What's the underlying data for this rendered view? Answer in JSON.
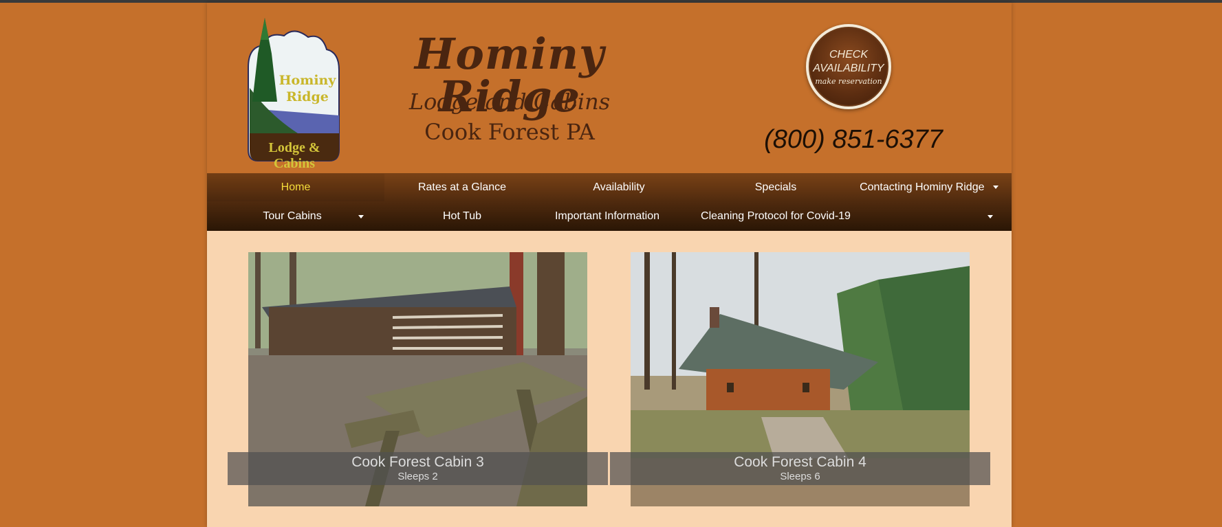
{
  "logo": {
    "line1": "Hominy",
    "line2": "Ridge",
    "line3": "Lodge & Cabins"
  },
  "header": {
    "title": "Hominy Ridge",
    "subtitle1": "Lodge and Cabins",
    "subtitle2": "Cook Forest PA",
    "check_availability": {
      "line1": "CHECK",
      "line2": "AVAILABILITY",
      "line3": "make reservation"
    },
    "phone": "(800) 851-6377"
  },
  "nav": {
    "row1": [
      {
        "label": "Home",
        "active": true
      },
      {
        "label": "Rates at a Glance"
      },
      {
        "label": "Availability"
      },
      {
        "label": "Specials"
      },
      {
        "label": "Contacting Hominy Ridge",
        "dropdown": true
      }
    ],
    "row2": [
      {
        "label": "Tour Cabins",
        "dropdown": true
      },
      {
        "label": "Hot Tub"
      },
      {
        "label": "Important Information",
        "dropdown": true
      },
      {
        "label": "Cleaning Protocol for Covid-19"
      }
    ]
  },
  "cabins": [
    {
      "title": "Cook Forest Cabin 3",
      "sleeps": "Sleeps 2"
    },
    {
      "title": "Cook Forest Cabin 4",
      "sleeps": "Sleeps 6"
    }
  ],
  "colors": {
    "page_bg": "#c5702b",
    "content_bg": "#f9d5b0",
    "nav_active": "#f5dd3a",
    "title_brown": "#4a2510"
  }
}
